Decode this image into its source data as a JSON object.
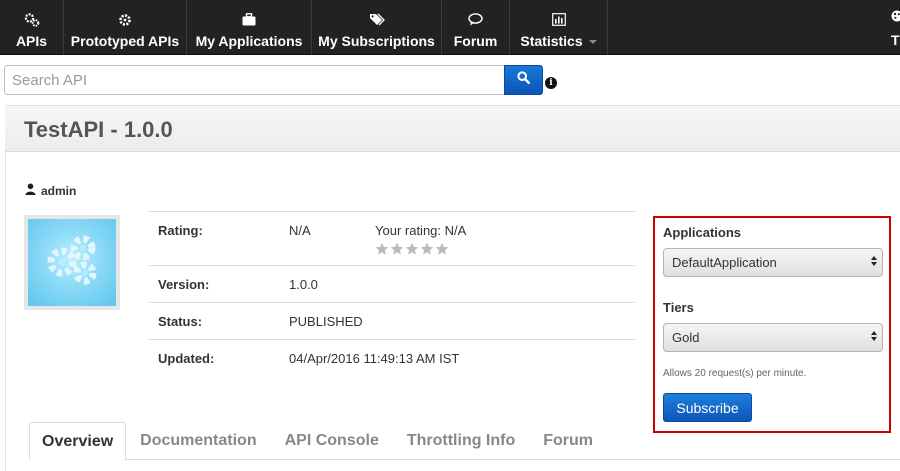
{
  "nav": {
    "items": [
      {
        "label": "APIs",
        "icon": "gears-icon"
      },
      {
        "label": "Prototyped APIs",
        "icon": "gear-icon"
      },
      {
        "label": "My Applications",
        "icon": "briefcase-icon"
      },
      {
        "label": "My Subscriptions",
        "icon": "tags-icon"
      },
      {
        "label": "Forum",
        "icon": "chat-bubble-icon"
      },
      {
        "label": "Statistics",
        "icon": "bar-chart-icon"
      }
    ],
    "right_label": "Themes"
  },
  "search": {
    "placeholder": "Search API"
  },
  "api": {
    "title": "TestAPI - 1.0.0",
    "owner": "admin",
    "rating_label": "Rating:",
    "rating_value": "N/A",
    "your_rating_label": "Your rating:",
    "your_rating_value": "N/A",
    "stars_filled": 0,
    "stars_total": 5,
    "version_label": "Version:",
    "version_value": "1.0.0",
    "status_label": "Status:",
    "status_value": "PUBLISHED",
    "updated_label": "Updated:",
    "updated_value": "04/Apr/2016 11:49:13 AM IST"
  },
  "subscribe": {
    "applications_label": "Applications",
    "application_selected": "DefaultApplication",
    "tiers_label": "Tiers",
    "tier_selected": "Gold",
    "tier_note": "Allows 20 request(s) per minute.",
    "button_label": "Subscribe"
  },
  "tabs": [
    {
      "label": "Overview",
      "active": true
    },
    {
      "label": "Documentation",
      "active": false
    },
    {
      "label": "API Console",
      "active": false
    },
    {
      "label": "Throttling Info",
      "active": false
    },
    {
      "label": "Forum",
      "active": false
    }
  ],
  "colors": {
    "nav_bg": "#222222",
    "accent_blue": "#0d57b8",
    "highlight_border": "#cc0000"
  }
}
